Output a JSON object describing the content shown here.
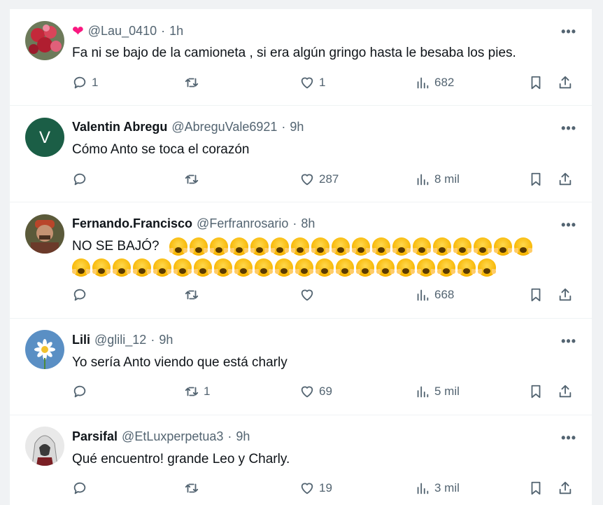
{
  "tweets": [
    {
      "name": "",
      "badge": "❤",
      "handle": "@Lau_0410",
      "time": "1h",
      "text": "Fa ni se bajo de la camioneta , si era algún gringo hasta le besaba los pies.",
      "replies": "1",
      "retweets": "",
      "likes": "1",
      "views": "682",
      "avatar": "flowers-photo"
    },
    {
      "name": "Valentin Abregu",
      "handle": "@AbreguVale6921",
      "time": "9h",
      "text": "Cómo Anto se toca el corazón",
      "replies": "",
      "retweets": "",
      "likes": "287",
      "views": "8 mil",
      "avatar_letter": "V",
      "avatar_color": "#1b5e46"
    },
    {
      "name": "Fernando.Francisco",
      "handle": "@Ferfranrosario",
      "time": "8h",
      "text": "NO SE BAJÓ?",
      "emoji": "😱",
      "emoji_count_line1": 18,
      "emoji_count_line2": 21,
      "replies": "",
      "retweets": "",
      "likes": "",
      "views": "668",
      "avatar": "man-with-cap-photo"
    },
    {
      "name": "Lili",
      "handle": "@glili_12",
      "time": "9h",
      "text": "Yo sería Anto viendo que está charly",
      "replies": "",
      "retweets": "1",
      "likes": "69",
      "views": "5 mil",
      "avatar": "daisy-on-blue-photo"
    },
    {
      "name": "Parsifal",
      "handle": "@EtLuxperpetua3",
      "time": "9h",
      "text": "Qué encuentro! grande Leo y Charly.",
      "replies": "",
      "retweets": "",
      "likes": "19",
      "views": "3 mil",
      "avatar": "hooded-figure-photo"
    }
  ],
  "separator": "·",
  "more_label": "•••",
  "icons": [
    "reply-icon",
    "retweet-icon",
    "like-icon",
    "views-icon",
    "bookmark-icon",
    "share-icon",
    "more-icon"
  ]
}
